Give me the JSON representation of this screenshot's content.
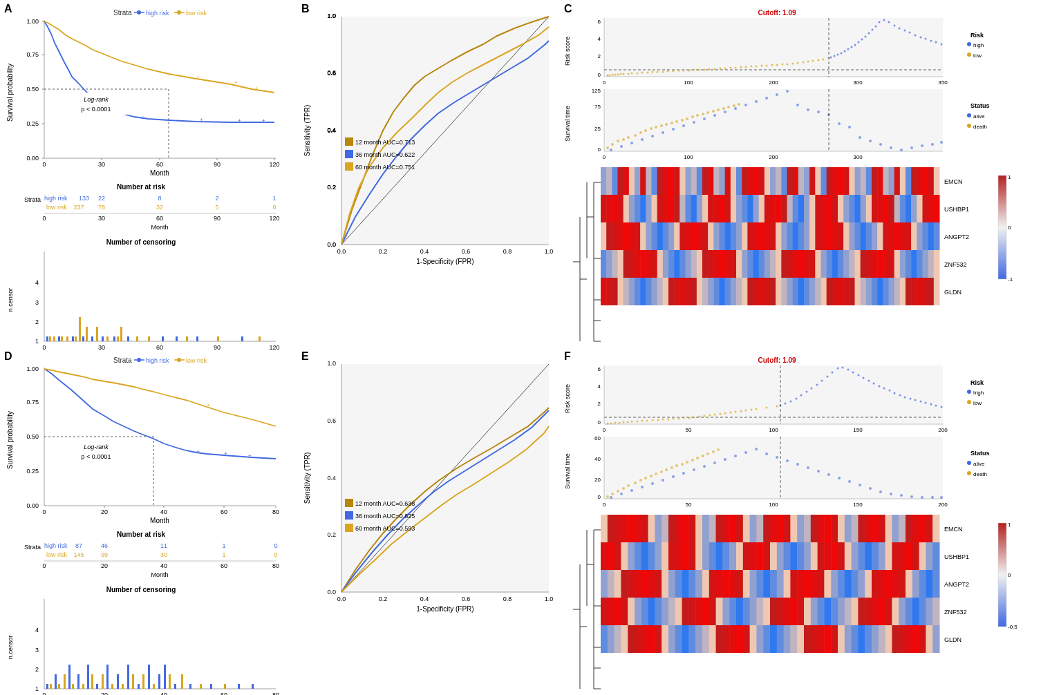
{
  "panels": {
    "A": {
      "label": "A",
      "title": "Strata",
      "legend": {
        "high": "high risk",
        "low": "low risk"
      },
      "logrank": "Log-rank\np < 0.0001",
      "xaxis": "Month",
      "yaxis": "Survival probability",
      "risk_table": {
        "title": "Number at risk",
        "high_label": "high risk",
        "low_label": "low risk",
        "strata_label": "Strata",
        "high_values": [
          "133",
          "22",
          "8",
          "2",
          "1"
        ],
        "low_values": [
          "237",
          "78",
          "32",
          "5",
          "0"
        ],
        "x_labels": [
          "0",
          "30",
          "60",
          "90",
          "120"
        ]
      },
      "censor_title": "Number of censoring",
      "censor_ylabel": "n.censor"
    },
    "B": {
      "label": "B",
      "xaxis": "1-Specificity (FPR)",
      "yaxis": "Sensitivity (TPR)",
      "curves": [
        {
          "label": "12 month AUC=0.713",
          "color": "#b8860b"
        },
        {
          "label": "36 month AUC=0.622",
          "color": "#4169e1"
        },
        {
          "label": "60 month AUC=0.751",
          "color": "#daa520"
        }
      ]
    },
    "C": {
      "label": "C",
      "cutoff_title": "Cutoff: 1.09",
      "risk_ylabel": "Risk score",
      "survival_ylabel": "Survival time",
      "risk_legend": {
        "high": "high",
        "low": "low",
        "title": "Risk"
      },
      "status_legend": {
        "alive": "alive",
        "death": "death",
        "title": "Status"
      },
      "genes": [
        "EMCN",
        "USHBP1",
        "ANGPT2",
        "ZNF532",
        "GLDN"
      ],
      "colorbar_max": "1",
      "colorbar_mid": "0",
      "colorbar_min": "-1",
      "x_max": "300"
    },
    "D": {
      "label": "D",
      "title": "Strata",
      "legend": {
        "high": "high risk",
        "low": "low risk"
      },
      "logrank": "Log-rank\np < 0.0001",
      "xaxis": "Month",
      "yaxis": "Survival probability",
      "risk_table": {
        "title": "Number at risk",
        "high_label": "high risk",
        "low_label": "low risk",
        "strata_label": "Strata",
        "high_values": [
          "87",
          "46",
          "11",
          "1",
          "0"
        ],
        "low_values": [
          "145",
          "99",
          "30",
          "1",
          "0"
        ],
        "x_labels": [
          "0",
          "20",
          "40",
          "60",
          "80"
        ]
      },
      "censor_title": "Number of censoring",
      "censor_ylabel": "n.censor"
    },
    "E": {
      "label": "E",
      "xaxis": "1-Specificity (FPR)",
      "yaxis": "Sensitivity (TPR)",
      "curves": [
        {
          "label": "12 month AUC=0.638",
          "color": "#b8860b"
        },
        {
          "label": "36 month AUC=0.625",
          "color": "#4169e1"
        },
        {
          "label": "60 month AUC=0.593",
          "color": "#daa520"
        }
      ]
    },
    "F": {
      "label": "F",
      "cutoff_title": "Cutoff: 1.09",
      "risk_ylabel": "Risk score",
      "survival_ylabel": "Survival time",
      "risk_legend": {
        "high": "high",
        "low": "low",
        "title": "Risk"
      },
      "status_legend": {
        "alive": "alive",
        "death": "death",
        "title": "Status"
      },
      "genes": [
        "EMCN",
        "USHBP1",
        "ANGPT2",
        "ZNF532",
        "GLDN"
      ],
      "colorbar_max": "1",
      "colorbar_mid": "0",
      "colorbar_min": "-0.5",
      "x_max": "200"
    }
  },
  "colors": {
    "high_risk": "#4169e1",
    "low_risk": "#daa520",
    "high_risk_text": "#4169e1",
    "low_risk_text": "#cc8800",
    "heatmap_red": "#b22222",
    "heatmap_blue": "#4169e1",
    "heatmap_white": "#f0f0f0"
  }
}
